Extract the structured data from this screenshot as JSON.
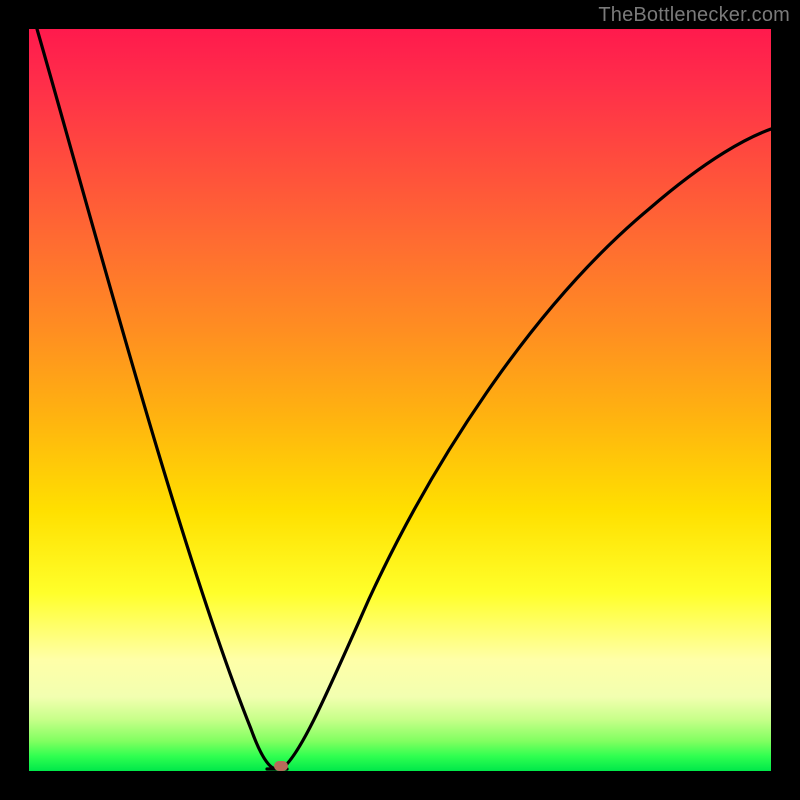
{
  "attribution": "TheBottlenecker.com",
  "chart_data": {
    "type": "line",
    "title": "",
    "xlabel": "",
    "ylabel": "",
    "xlim": [
      0,
      100
    ],
    "ylim": [
      0,
      100
    ],
    "grid": false,
    "legend": false,
    "series": [
      {
        "name": "bottleneck-curve",
        "x": [
          0,
          3,
          6,
          9,
          12,
          15,
          18,
          21,
          24,
          27,
          29,
          31,
          32,
          33,
          34,
          36,
          38,
          41,
          45,
          50,
          56,
          63,
          71,
          80,
          90,
          100
        ],
        "values": [
          100,
          91,
          82,
          73,
          64,
          55,
          46,
          37,
          28,
          19,
          11,
          4,
          1,
          0,
          0,
          3,
          8,
          15,
          24,
          34,
          45,
          55,
          64,
          72,
          79,
          85
        ]
      }
    ],
    "marker": {
      "x": 33.5,
      "y": 0.6
    },
    "gradient_stops": [
      {
        "pct": 0,
        "hex": "#ff1a4d"
      },
      {
        "pct": 17,
        "hex": "#ff4a3e"
      },
      {
        "pct": 40,
        "hex": "#ff8c22"
      },
      {
        "pct": 65,
        "hex": "#ffe000"
      },
      {
        "pct": 85,
        "hex": "#ffffa8"
      },
      {
        "pct": 96,
        "hex": "#80ff60"
      },
      {
        "pct": 100,
        "hex": "#00e84a"
      }
    ]
  },
  "colors": {
    "frame": "#000000",
    "curve": "#000000",
    "marker": "#b76a5a",
    "attribution": "#7a7a7a"
  }
}
